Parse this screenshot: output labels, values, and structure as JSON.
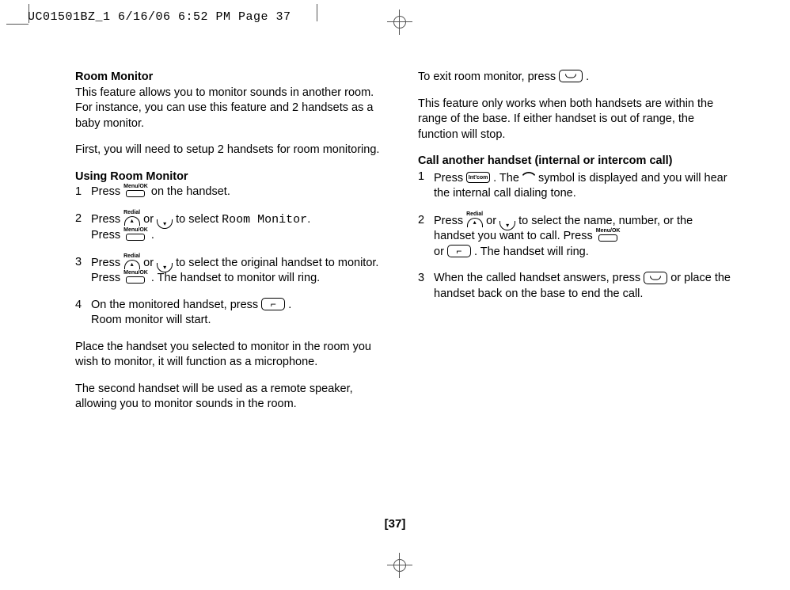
{
  "header": {
    "slug": "UC01501BZ_1  6/16/06  6:52 PM  Page 37"
  },
  "left": {
    "title1": "Room Monitor",
    "intro": "This feature allows you to monitor sounds in another room. For instance, you can use this feature and 2 handsets as a baby monitor.",
    "setup_note": "First, you will need to setup 2 handsets for room monitoring.",
    "title2": "Using Room Monitor",
    "step1_a": "Press",
    "step1_b": "on the handset.",
    "step2_a": "Press",
    "step2_b": "or",
    "step2_c": "to select",
    "step2_label": "Room Monitor",
    "step2_d": ".",
    "step2_e": "Press",
    "step2_f": ".",
    "step3_a": "Press",
    "step3_b": "or",
    "step3_c": "to select the original handset to monitor.",
    "step3_d": "Press",
    "step3_e": ". The handset to monitor will ring.",
    "step4_a": "On the monitored handset, press",
    "step4_b": ".",
    "step4_c": "Room monitor will start.",
    "place_note": "Place the handset you selected to monitor in the room you wish to monitor, it will function as a microphone.",
    "speaker_note": "The second handset will be used as a remote speaker, allowing you to monitor sounds in the room."
  },
  "right": {
    "exit_a": "To exit room monitor, press",
    "exit_b": ".",
    "range_note": "This feature only works when both handsets are within the range of the base. If either handset is out of range, the function will stop.",
    "title": "Call another handset (internal or intercom call)",
    "step1_a": "Press",
    "step1_b": ". The",
    "step1_c": "symbol is displayed and you will hear the internal call dialing tone.",
    "step2_a": "Press",
    "step2_b": "or",
    "step2_c": "to select the name, number, or the handset you want to call. Press",
    "step2_d": "or",
    "step2_e": ". The handset will ring.",
    "step3_a": "When the called handset answers, press",
    "step3_b": "or place the handset back on the base to end the call.",
    "intcom_label": "Int'com"
  },
  "icons": {
    "menuok_label": "Menu/OK",
    "redial_label": "Redial"
  },
  "page_number": "[37]"
}
